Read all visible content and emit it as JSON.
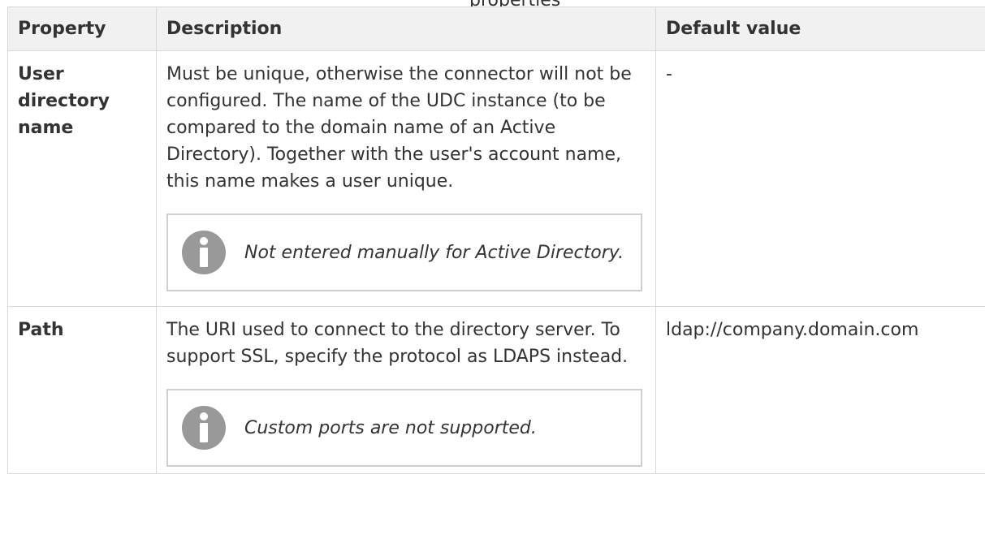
{
  "caption": "properties",
  "table": {
    "headers": {
      "property": "Property",
      "description": "Description",
      "default": "Default value"
    },
    "rows": [
      {
        "property": "User directory name",
        "description": "Must be unique, otherwise the connector will not be configured. The name of the UDC instance (to be compared to the domain name of an Active Directory). Together with the user's account name, this name makes a user unique.",
        "note": "Not entered manually for Active Directory.",
        "default": "-"
      },
      {
        "property": "Path",
        "description": "The URI used to connect to the directory server. To support SSL, specify the protocol as LDAPS instead.",
        "note": "Custom ports are not supported.",
        "default": "ldap://company.domain.com"
      }
    ]
  },
  "icons": {
    "note_icon": "info-icon",
    "note_icon_color": "#999999"
  },
  "colors": {
    "header_bg": "#f1f1f1",
    "border": "#d8d8d8",
    "text": "#333333"
  }
}
